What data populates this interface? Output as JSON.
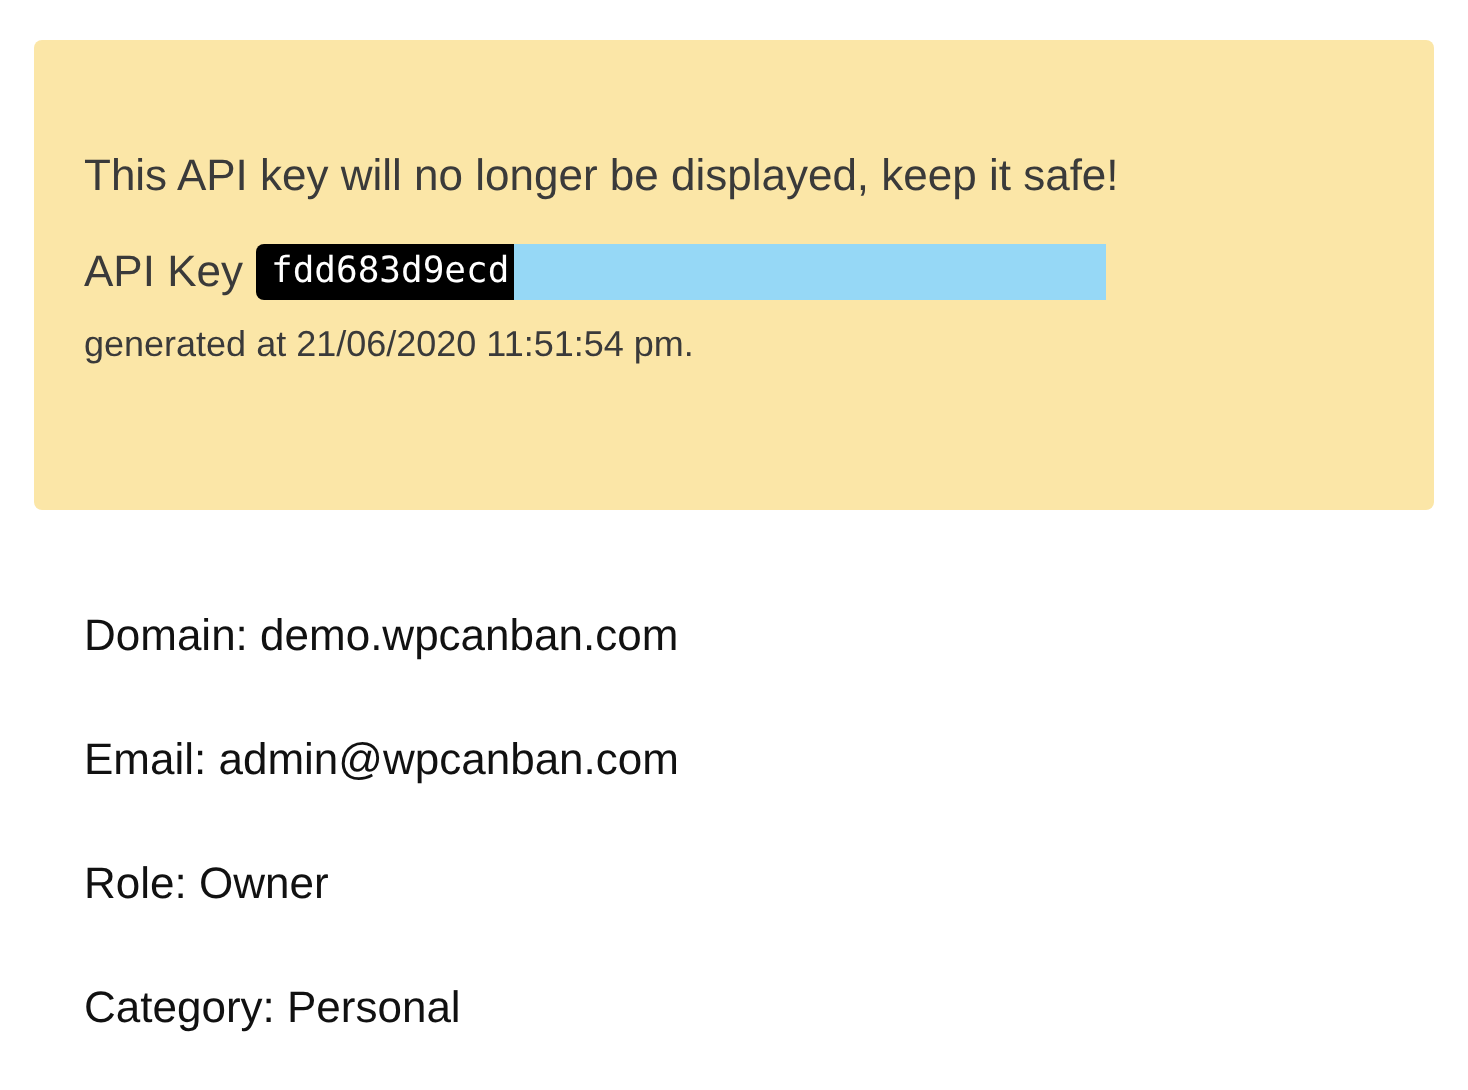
{
  "alert": {
    "message": "This API key will no longer be displayed, keep it safe!",
    "key_label": "API Key",
    "key_value": "fdd683d9ecd",
    "generated": "generated at 21/06/2020 11:51:54 pm."
  },
  "details": [
    "Domain: demo.wpcanban.com",
    "Email: admin@wpcanban.com",
    "Role: Owner",
    "Category: Personal"
  ]
}
